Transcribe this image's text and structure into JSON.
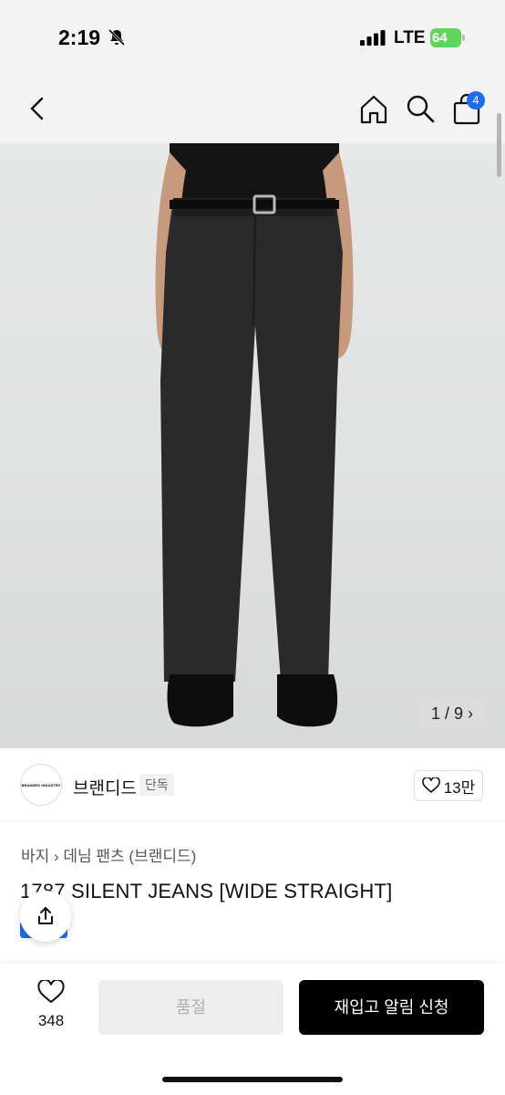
{
  "status_bar": {
    "time": "2:19",
    "carrier": "LTE",
    "battery": "64"
  },
  "nav": {
    "cart_badge": "4"
  },
  "gallery": {
    "counter": "1 / 9"
  },
  "brand": {
    "logo_text": "BRANDED INDUSTRY",
    "name": "브랜디드",
    "tag": "단독",
    "likes": "13만"
  },
  "product": {
    "breadcrumb": [
      "바지",
      "데님 팬츠 (브랜디드)"
    ],
    "title": "1787 SILENT JEANS [WIDE STRAIGHT]"
  },
  "bottom_bar": {
    "wish_count": "348",
    "soldout_label": "품절",
    "restock_label": "재입고 알림 신청"
  },
  "colors": {
    "accent": "#1d6cf0",
    "battery": "#5fd65a",
    "nav_bg": "#f3f3f3"
  }
}
